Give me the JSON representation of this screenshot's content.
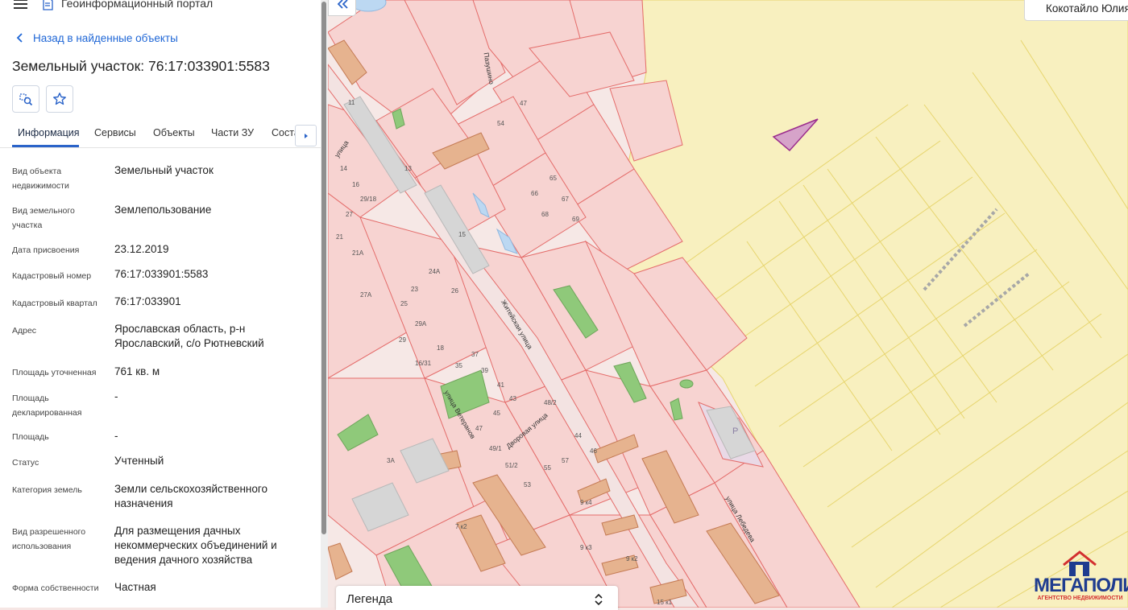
{
  "header": {
    "menu_icon": "hamburger-icon",
    "logo_icon": "portal-logo-icon",
    "title": "Геоинформационный портал"
  },
  "back_link": {
    "label": "Назад в найденные объекты"
  },
  "object": {
    "title": "Земельный участок: 76:17:033901:5583"
  },
  "actions": {
    "locate_icon": "locate-on-map-icon",
    "favorite_icon": "star-icon"
  },
  "tabs": {
    "items": [
      {
        "label": "Информация",
        "active": true
      },
      {
        "label": "Сервисы"
      },
      {
        "label": "Объекты"
      },
      {
        "label": "Части ЗУ"
      },
      {
        "label": "Состав ЗУ"
      }
    ],
    "cut_label": "Соста"
  },
  "properties": [
    {
      "label": "Вид объекта недвижимости",
      "value": "Земельный участок"
    },
    {
      "label": "Вид земельного участка",
      "value": "Землепользование"
    },
    {
      "label": "Дата присвоения",
      "value": "23.12.2019"
    },
    {
      "label": "Кадастровый номер",
      "value": "76:17:033901:5583"
    },
    {
      "label": "Кадастровый квартал",
      "value": "76:17:033901"
    },
    {
      "label": "Адрес",
      "value": "Ярославская область, р-н Ярославский, с/о Рютневский"
    },
    {
      "label": "Площадь уточненная",
      "value": "761 кв. м"
    },
    {
      "label": "Площадь декларированная",
      "value": "-"
    },
    {
      "label": "Площадь",
      "value": "-"
    },
    {
      "label": "Статус",
      "value": "Учтенный"
    },
    {
      "label": "Категория земель",
      "value": "Земли сельскохозяйственного назначения"
    },
    {
      "label": "Вид разрешенного использования",
      "value": "Для размещения дачных некоммерческих объединений и ведения дачного хозяйства"
    },
    {
      "label": "Форма собственности",
      "value": "Частная"
    }
  ],
  "map": {
    "collapse_icon": "double-chevron-left-icon",
    "user_name": "Кокотайло Юлия",
    "legend_title": "Легенда",
    "legend_toggle_icon": "chevron-up-down-icon",
    "streets": [
      "Житейская улица",
      "Дворовая улица",
      "улица Ветеранов",
      "улица Лебедева",
      "улица",
      "Пазушино"
    ],
    "parcel_numbers": [
      "11",
      "13",
      "15",
      "14",
      "16",
      "29/18",
      "27",
      "21",
      "21A",
      "27А",
      "25",
      "29А",
      "29",
      "23",
      "24А",
      "26",
      "18",
      "16/31",
      "35",
      "37",
      "39",
      "41",
      "43",
      "45",
      "47",
      "49/1",
      "51/2",
      "53",
      "55",
      "57",
      "44",
      "46",
      "48/2",
      "47",
      "54",
      "65",
      "66",
      "67",
      "68",
      "69",
      "3А",
      "9 к2",
      "9 к3",
      "9 к4",
      "7 к2",
      "15 к1",
      "Р"
    ],
    "colors": {
      "parcel_fill": "#f7d3d1",
      "parcel_stroke": "#e46c6a",
      "field_fill": "#f8f0bf",
      "field_stroke": "#e7d56e",
      "building_fill": "#e6b38f",
      "green_fill": "#8fc97a",
      "highlight_fill": "#d6a3c9",
      "highlight_stroke": "#9b2d8d"
    }
  },
  "logo": {
    "name": "МЕГАПОЛИС",
    "subtitle": "АГЕНТСТВО НЕДВИЖИМОСТИ"
  }
}
